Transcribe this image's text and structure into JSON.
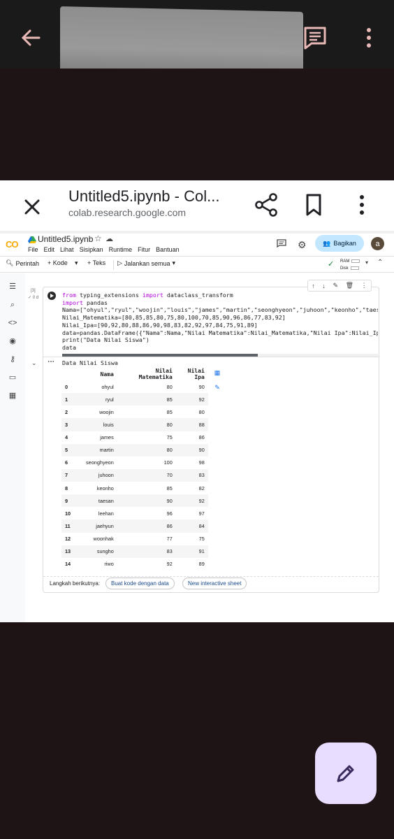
{
  "browser": {
    "tab_title": "Untitled5.ipynb - Col...",
    "url": "colab.research.google.com"
  },
  "colab": {
    "logo": "CO",
    "notebook_name": "Untitled5.ipynb",
    "menu": [
      "File",
      "Edit",
      "Lihat",
      "Sisipkan",
      "Runtime",
      "Fitur",
      "Bantuan"
    ],
    "share_label": "Bagikan",
    "avatar_letter": "a",
    "toolbar": {
      "command": "Perintah",
      "add_code": "+ Kode",
      "add_text": "+ Teks",
      "run_all": "Jalankan semua",
      "ram": "RAM",
      "disk": "Disk"
    }
  },
  "cell": {
    "exec_count": "[3]",
    "exec_status": "✓ 0 d",
    "code_lines": [
      "from typing_extensions import dataclass_transform",
      "import pandas",
      "Nama=[\"ohyul\",\"ryul\",\"woojin\",\"louis\",\"james\",\"martin\",\"seonghyeon\",\"juhoon\",\"keonho\",\"taesan",
      "Nilai_Matematika=[80,85,85,80,75,80,100,70,85,90,96,86,77,83,92]",
      "Nilai_Ipa=[90,92,80,88,86,90,98,83,82,92,97,84,75,91,89]",
      "data=pandas.DataFrame({\"Nama\":Nama,\"Nilai Matematika\":Nilai_Matematika,\"Nilai Ipa\":Nilai_Ipa",
      "print(\"Data Nilai Siswa\")",
      "data"
    ],
    "output_print": "Data Nilai Siswa",
    "table": {
      "columns": [
        "Nama",
        "Nilai Matematika",
        "Nilai Ipa"
      ],
      "rows": [
        [
          "0",
          "ohyul",
          "80",
          "90"
        ],
        [
          "1",
          "ryul",
          "85",
          "92"
        ],
        [
          "2",
          "woojin",
          "85",
          "80"
        ],
        [
          "3",
          "louis",
          "80",
          "88"
        ],
        [
          "4",
          "james",
          "75",
          "86"
        ],
        [
          "5",
          "martin",
          "80",
          "90"
        ],
        [
          "6",
          "seonghyeon",
          "100",
          "98"
        ],
        [
          "7",
          "juhoon",
          "70",
          "83"
        ],
        [
          "8",
          "keonho",
          "85",
          "82"
        ],
        [
          "9",
          "taesan",
          "90",
          "92"
        ],
        [
          "10",
          "leehan",
          "96",
          "97"
        ],
        [
          "11",
          "jaehyun",
          "86",
          "84"
        ],
        [
          "12",
          "woonhak",
          "77",
          "75"
        ],
        [
          "13",
          "sungho",
          "83",
          "91"
        ],
        [
          "14",
          "riwo",
          "92",
          "89"
        ]
      ]
    },
    "next_steps_label": "Langkah berikutnya:",
    "next_btn_1": "Buat kode dengan data",
    "next_btn_2": "New interactive sheet"
  }
}
